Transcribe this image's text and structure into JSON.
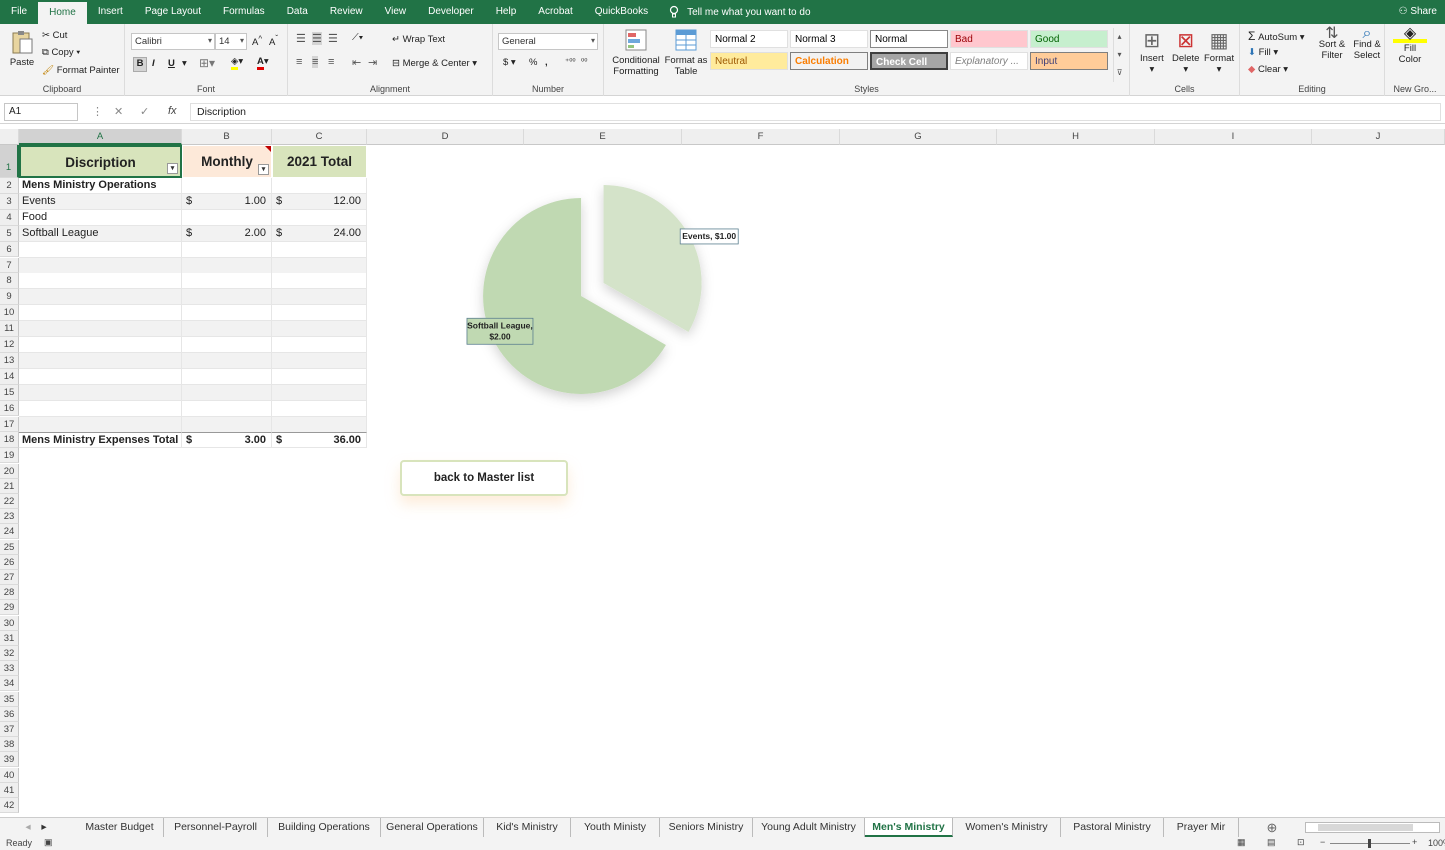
{
  "menu": {
    "tabs": [
      "File",
      "Home",
      "Insert",
      "Page Layout",
      "Formulas",
      "Data",
      "Review",
      "View",
      "Developer",
      "Help",
      "Acrobat",
      "QuickBooks"
    ],
    "active": "Home",
    "tell_me": "Tell me what you want to do",
    "share": "Share"
  },
  "ribbon": {
    "clipboard": {
      "paste": "Paste",
      "cut": "Cut",
      "copy": "Copy",
      "format_painter": "Format Painter",
      "label": "Clipboard"
    },
    "font": {
      "name": "Calibri",
      "size": "14",
      "label": "Font",
      "bold": "B",
      "italic": "I",
      "underline": "U"
    },
    "alignment": {
      "wrap": "Wrap Text",
      "merge": "Merge & Center",
      "label": "Alignment"
    },
    "number": {
      "format": "General",
      "label": "Number",
      "currency": "$",
      "percent": "%",
      "comma": ","
    },
    "styles": {
      "conditional": "Conditional Formatting",
      "format_table": "Format as Table",
      "cells": [
        {
          "name": "Normal 2",
          "bg": "#ffffff",
          "fg": "#000000"
        },
        {
          "name": "Normal 3",
          "bg": "#ffffff",
          "fg": "#000000"
        },
        {
          "name": "Normal",
          "bg": "#ffffff",
          "fg": "#000000"
        },
        {
          "name": "Bad",
          "bg": "#ffc7ce",
          "fg": "#9c0006"
        },
        {
          "name": "Good",
          "bg": "#c6efce",
          "fg": "#006100"
        },
        {
          "name": "Neutral",
          "bg": "#ffeb9c",
          "fg": "#9c5700"
        },
        {
          "name": "Calculation",
          "bg": "#f2f2f2",
          "fg": "#fa7d00"
        },
        {
          "name": "Check Cell",
          "bg": "#a5a5a5",
          "fg": "#ffffff"
        },
        {
          "name": "Explanatory ...",
          "bg": "#ffffff",
          "fg": "#7f7f7f"
        },
        {
          "name": "Input",
          "bg": "#ffcc99",
          "fg": "#3f3f76"
        }
      ],
      "label": "Styles"
    },
    "cells": {
      "insert": "Insert",
      "delete": "Delete",
      "format": "Format",
      "label": "Cells"
    },
    "editing": {
      "autosum": "AutoSum",
      "fill": "Fill",
      "clear": "Clear",
      "sort": "Sort & Filter",
      "find": "Find & Select",
      "label": "Editing"
    },
    "newgroup": {
      "fill_color": "Fill Color",
      "label": "New Gro..."
    }
  },
  "formula_bar": {
    "name_box": "A1",
    "content": "Discription"
  },
  "columns": [
    "A",
    "B",
    "C",
    "D",
    "E",
    "F",
    "G",
    "H",
    "I",
    "J"
  ],
  "table": {
    "headers": [
      "Discription",
      "Monthly",
      "2021 Total"
    ],
    "header_colors": [
      "#d8e4bc",
      "#fde9d9",
      "#d8e4bc"
    ],
    "rows": [
      {
        "a": "Mens Ministry Operations",
        "bold": true,
        "b_sym": "",
        "b": "",
        "c_sym": "",
        "c": ""
      },
      {
        "a": "Events",
        "bold": false,
        "b_sym": "$",
        "b": "1.00",
        "c_sym": "$",
        "c": "12.00"
      },
      {
        "a": "Food",
        "bold": false,
        "b_sym": "",
        "b": "",
        "c_sym": "",
        "c": ""
      },
      {
        "a": "Softball League",
        "bold": false,
        "b_sym": "$",
        "b": "2.00",
        "c_sym": "$",
        "c": "24.00"
      }
    ],
    "total": {
      "a": "Mens Ministry Expenses Total",
      "b_sym": "$",
      "b": "3.00",
      "c_sym": "$",
      "c": "36.00"
    }
  },
  "chart_data": {
    "type": "pie",
    "categories": [
      "Events",
      "Softball League"
    ],
    "values": [
      1.0,
      2.0
    ],
    "labels": [
      "Events,  $1.00",
      "Softball League, $2.00"
    ],
    "colors": [
      "#d4e3c9",
      "#c0d9b2"
    ],
    "exploded": true
  },
  "button": {
    "label": "back to Master list"
  },
  "sheets": [
    "Master Budget",
    "Personnel-Payroll",
    "Building Operations",
    "General Operations",
    "Kid's Ministry",
    "Youth Ministy",
    "Seniors Ministry",
    "Young Adult Ministry",
    "Men's Ministry",
    "Women's Ministry",
    "Pastoral Ministry",
    "Prayer Mir"
  ],
  "active_sheet": "Men's Ministry",
  "status": {
    "ready": "Ready",
    "zoom": "100%"
  }
}
